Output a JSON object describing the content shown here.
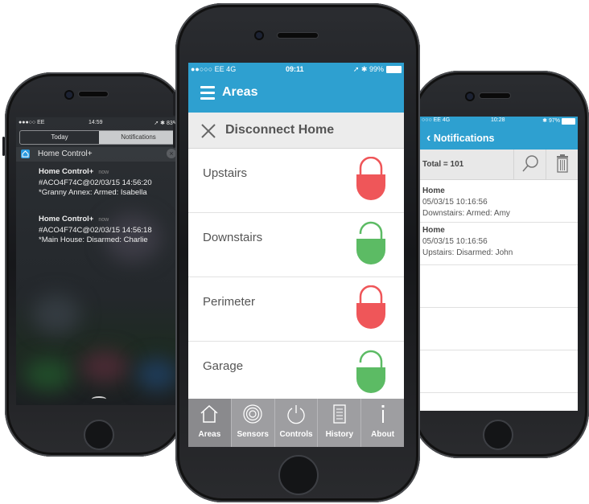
{
  "left_phone": {
    "status": {
      "carrier": "●●●○○ EE",
      "time": "14:59",
      "battery": "➚ ✱ 83%"
    },
    "tabs": [
      "Today",
      "Notifications"
    ],
    "selected_tab": "Notifications",
    "app_name": "Home Control+",
    "close": "×",
    "notifications": [
      {
        "title": "Home Control+",
        "time": "now",
        "line1": "#ACO4F74C@02/03/15 14:56:20",
        "line2": "*Granny Annex: Armed: Isabella"
      },
      {
        "title": "Home Control+",
        "time": "now",
        "line1": "#ACO4F74C@02/03/15 14:56:18",
        "line2": "*Main House: Disarmed: Charlie"
      }
    ]
  },
  "center_phone": {
    "status": {
      "carrier": "●●○○○ EE   4G",
      "time": "09:11",
      "battery": "➚ ✱ 99%"
    },
    "title": "Areas",
    "subheader": "Disconnect Home",
    "areas": [
      {
        "name": "Upstairs",
        "state": "locked"
      },
      {
        "name": "Downstairs",
        "state": "unlocked"
      },
      {
        "name": "Perimeter",
        "state": "locked"
      },
      {
        "name": "Garage",
        "state": "unlocked"
      }
    ],
    "colors": {
      "accent": "#2ea0d0",
      "locked": "#ef5659",
      "unlocked": "#5cbb64"
    },
    "tabbar": [
      {
        "label": "Areas",
        "icon": "home-icon"
      },
      {
        "label": "Sensors",
        "icon": "sensor-icon"
      },
      {
        "label": "Controls",
        "icon": "power-icon"
      },
      {
        "label": "History",
        "icon": "history-icon"
      },
      {
        "label": "About",
        "icon": "info-icon"
      }
    ]
  },
  "right_phone": {
    "status": {
      "carrier": "○○○ EE   4G",
      "time": "10:28",
      "battery": "✱ 97%"
    },
    "back": "‹",
    "title": "Notifications",
    "total": "Total = 101",
    "notifications": [
      {
        "title": "Home",
        "date": "05/03/15 10:16:56",
        "detail": "Downstairs: Armed: Amy"
      },
      {
        "title": "Home",
        "date": "05/03/15 10:16:56",
        "detail": "Upstairs: Disarmed: John"
      }
    ]
  }
}
